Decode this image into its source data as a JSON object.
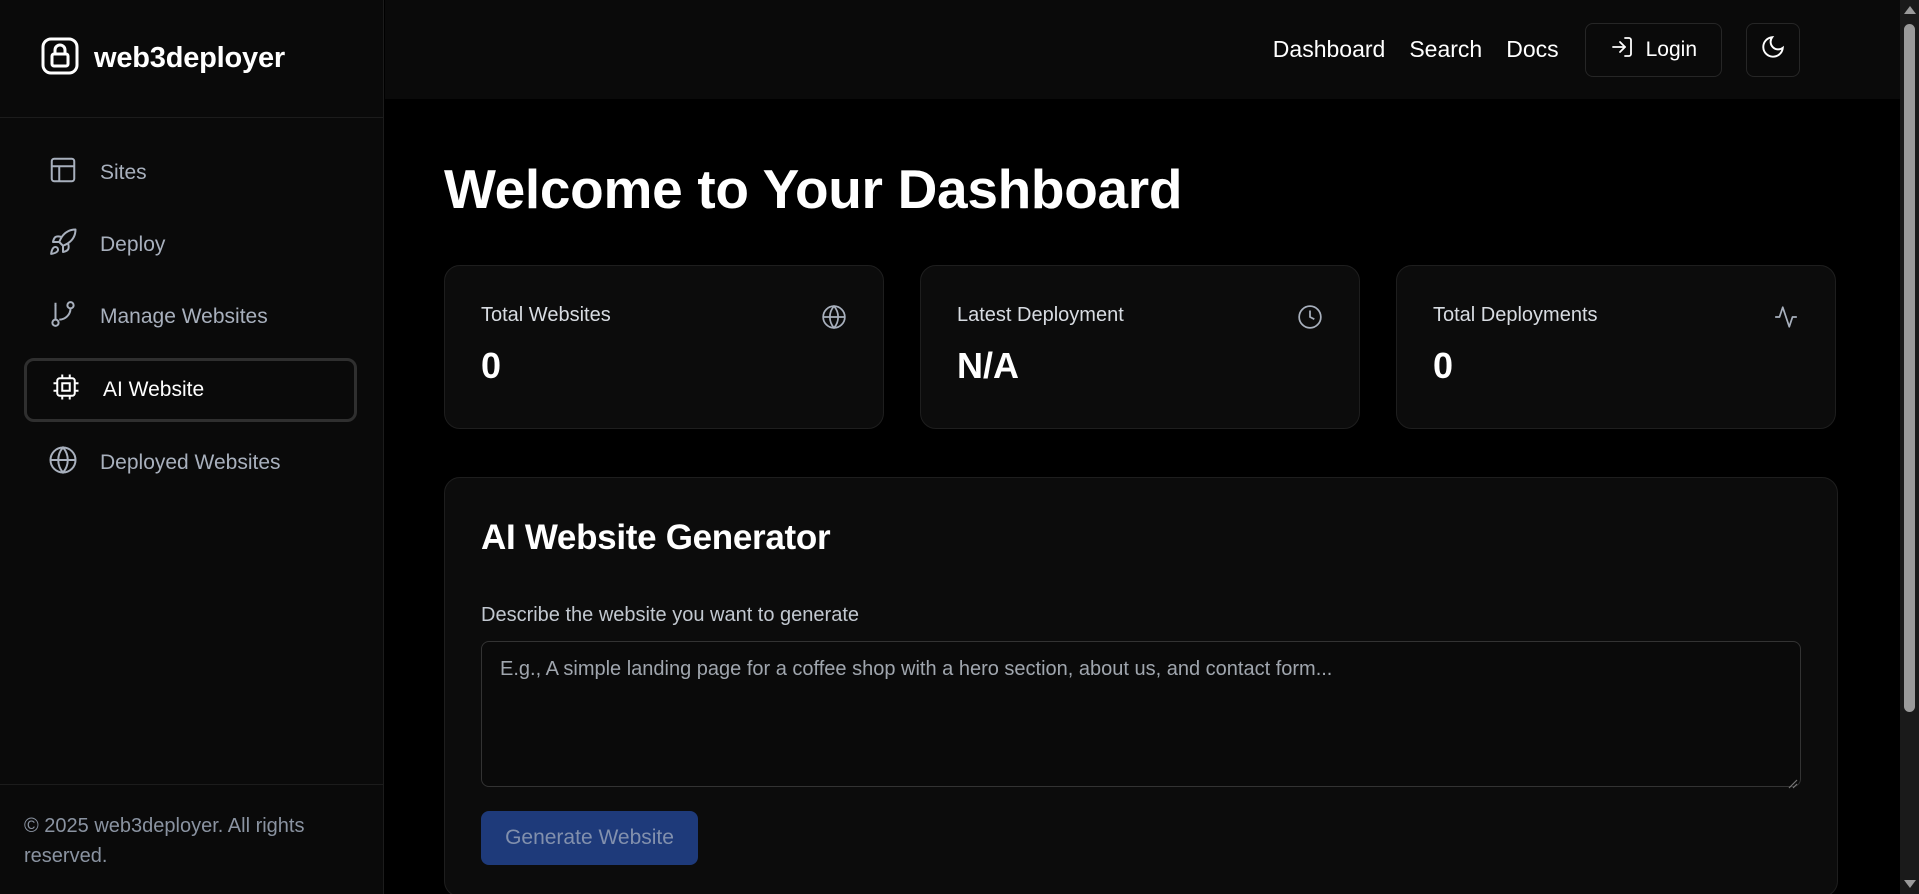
{
  "brand": {
    "name": "web3deployer"
  },
  "sidebar": {
    "items": [
      {
        "label": "Sites",
        "icon": "layout-icon"
      },
      {
        "label": "Deploy",
        "icon": "rocket-icon"
      },
      {
        "label": "Manage Websites",
        "icon": "git-branch-icon"
      },
      {
        "label": "AI Website",
        "icon": "cpu-icon",
        "active": true
      },
      {
        "label": "Deployed Websites",
        "icon": "globe-icon"
      }
    ],
    "footer": "© 2025 web3deployer. All rights reserved."
  },
  "topbar": {
    "links": [
      "Dashboard",
      "Search",
      "Docs"
    ],
    "login_label": "Login",
    "theme_icon": "moon-icon"
  },
  "main": {
    "title": "Welcome to Your Dashboard",
    "stats": [
      {
        "label": "Total Websites",
        "value": "0",
        "icon": "globe-icon"
      },
      {
        "label": "Latest Deployment",
        "value": "N/A",
        "icon": "clock-icon"
      },
      {
        "label": "Total Deployments",
        "value": "0",
        "icon": "activity-icon"
      }
    ],
    "generator": {
      "title": "AI Website Generator",
      "label": "Describe the website you want to generate",
      "placeholder": "E.g., A simple landing page for a coffee shop with a hero section, about us, and contact form...",
      "button_label": "Generate Website"
    }
  },
  "colors": {
    "background": "#000000",
    "sidebar": "#0a0a0a",
    "card": "#0c0c0c",
    "button_disabled": "#1e3a7a"
  }
}
